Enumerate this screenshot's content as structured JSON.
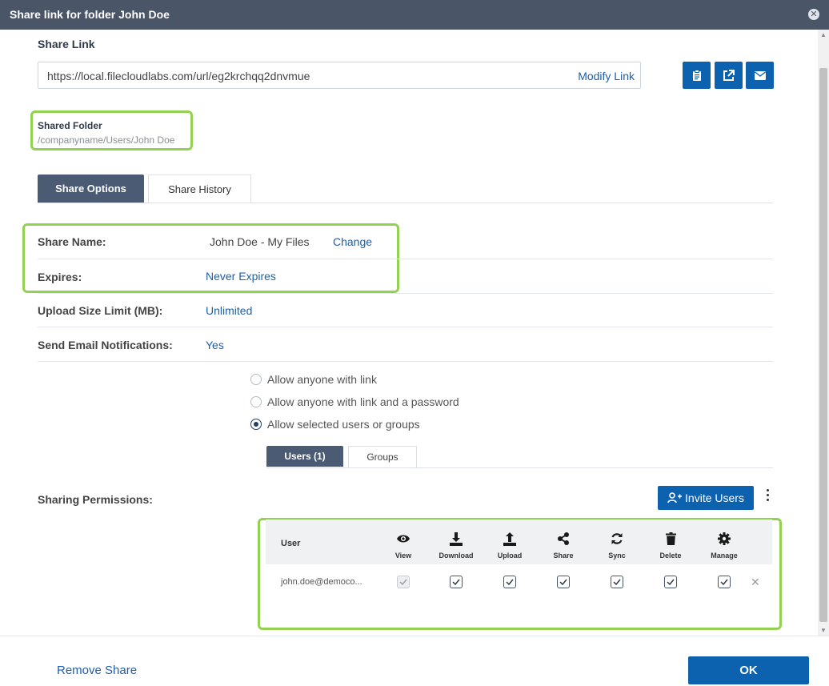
{
  "dialog": {
    "title": "Share link for folder John Doe",
    "close_icon": "close-icon"
  },
  "share_link": {
    "section_title": "Share Link",
    "url": "https://local.filecloudlabs.com/url/eg2krchqq2dnvmue",
    "modify_label": "Modify Link",
    "actions": [
      "clipboard-icon",
      "open-external-icon",
      "email-icon"
    ]
  },
  "shared_folder": {
    "title": "Shared Folder",
    "path": "/companyname/Users/John Doe"
  },
  "tabs": {
    "share_options": "Share Options",
    "share_history": "Share History"
  },
  "options": {
    "share_name_label": "Share Name:",
    "share_name_value": "John Doe - My Files",
    "share_name_change": "Change",
    "expires_label": "Expires:",
    "expires_value": "Never Expires",
    "upload_limit_label": "Upload Size Limit (MB):",
    "upload_limit_value": "Unlimited",
    "email_notif_label": "Send Email Notifications:",
    "email_notif_value": "Yes"
  },
  "access": {
    "options": [
      {
        "label": "Allow anyone with link",
        "checked": false
      },
      {
        "label": "Allow anyone with link and a password",
        "checked": false
      },
      {
        "label": "Allow selected users or groups",
        "checked": true
      }
    ]
  },
  "subtabs": {
    "users": "Users (1)",
    "groups": "Groups"
  },
  "permissions": {
    "label": "Sharing Permissions:",
    "invite_label": "Invite Users",
    "user_header": "User",
    "columns": [
      "View",
      "Download",
      "Upload",
      "Share",
      "Sync",
      "Delete",
      "Manage"
    ],
    "rows": [
      {
        "user": "john.doe@democo...",
        "view": true,
        "download": true,
        "upload": true,
        "share": true,
        "sync": true,
        "delete": true,
        "manage": true
      }
    ]
  },
  "footer": {
    "remove_share": "Remove Share",
    "ok": "OK"
  },
  "colors": {
    "primary": "#0d62b0",
    "header": "#4a5568",
    "highlight": "#93d152",
    "link": "#1f5fa8"
  }
}
